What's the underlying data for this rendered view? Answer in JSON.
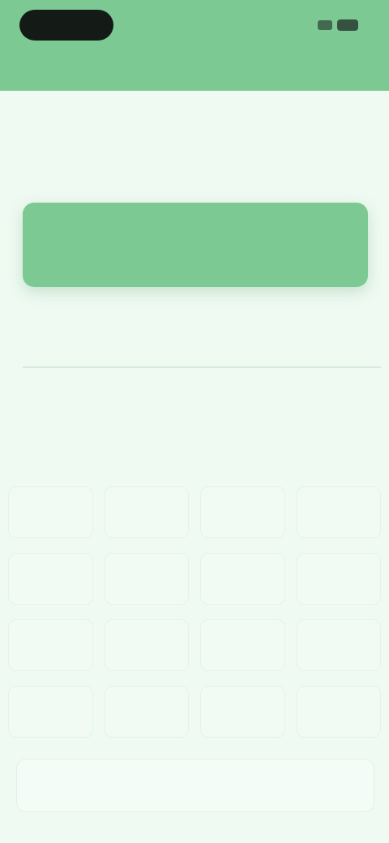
{
  "status": {
    "right_indicator_label": ""
  },
  "header": {
    "hint": "",
    "title": ""
  },
  "balance_card": {
    "label": "",
    "value": ""
  },
  "input": {
    "placeholder": ""
  },
  "keypad": {
    "keys": [
      "",
      "",
      "",
      "",
      "",
      "",
      "",
      "",
      "",
      "",
      "",
      "",
      "",
      "",
      "",
      ""
    ]
  },
  "confirm_button": {
    "label": ""
  },
  "colors": {
    "accent": "#7cc994",
    "background": "#effaf2"
  }
}
